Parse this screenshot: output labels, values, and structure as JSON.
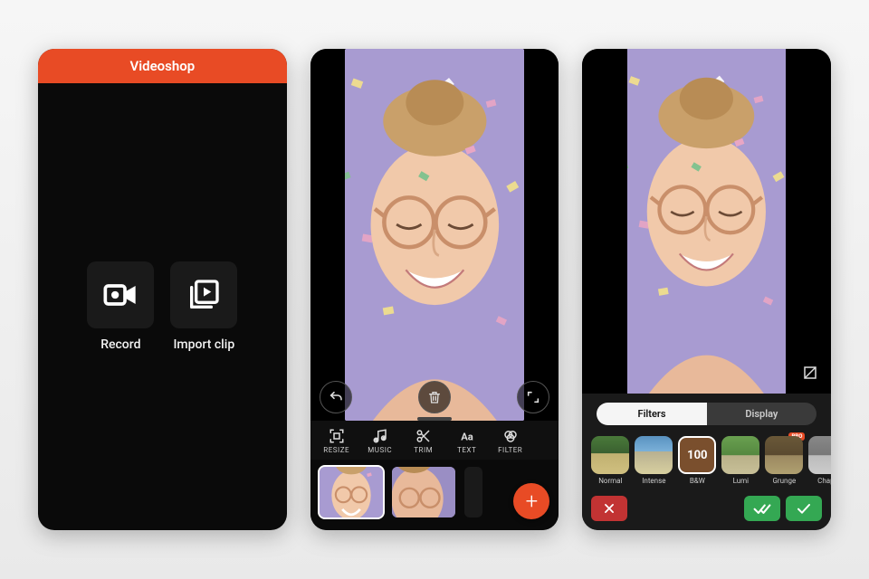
{
  "screen1": {
    "header_title": "Videoshop",
    "record_label": "Record",
    "import_label": "Import clip"
  },
  "screen2": {
    "tools": [
      {
        "icon": "resize",
        "label": "RESIZE"
      },
      {
        "icon": "music",
        "label": "MUSIC"
      },
      {
        "icon": "trim",
        "label": "TRIM"
      },
      {
        "icon": "text",
        "label": "TEXT"
      },
      {
        "icon": "filter",
        "label": "FILTER"
      }
    ],
    "add_label": "+"
  },
  "screen3": {
    "tabs": {
      "filters": "Filters",
      "display": "Display"
    },
    "filters": [
      {
        "key": "normal",
        "label": "Normal",
        "pro": false
      },
      {
        "key": "intense",
        "label": "Intense",
        "pro": false
      },
      {
        "key": "bw",
        "label": "B&W",
        "pro": false,
        "badge": "100"
      },
      {
        "key": "lumi",
        "label": "Lumi",
        "pro": false
      },
      {
        "key": "grunge",
        "label": "Grunge",
        "pro": true
      },
      {
        "key": "chaplin",
        "label": "Chapli",
        "pro": true
      }
    ],
    "pro_badge": "PRO"
  }
}
